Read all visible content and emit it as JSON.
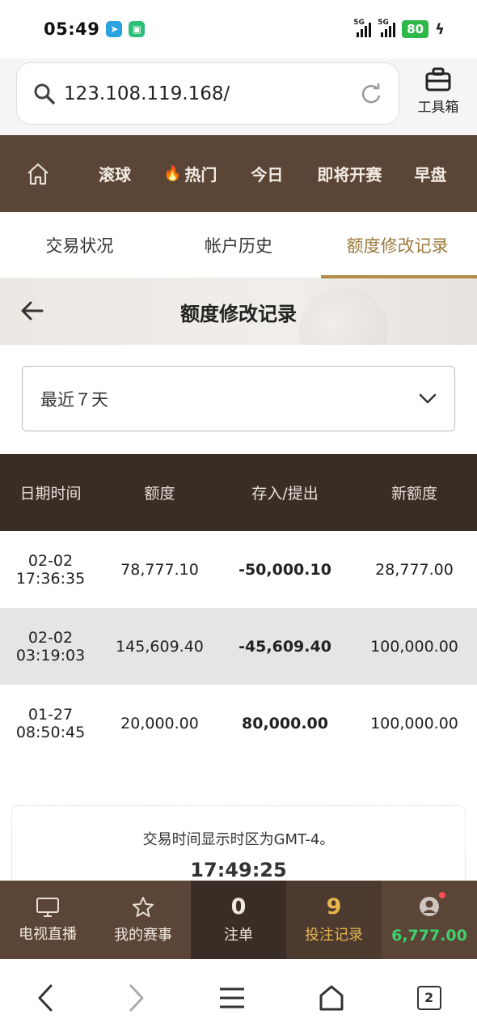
{
  "status": {
    "time": "05:49",
    "signal1": "5G",
    "signal2": "5G",
    "battery": "80"
  },
  "browser": {
    "url": "123.108.119.168/",
    "toolbox_label": "工具箱",
    "tab_count": "2"
  },
  "nav": {
    "items": [
      "滚球",
      "热门",
      "今日",
      "即将开赛",
      "早盘"
    ]
  },
  "tabs": [
    "交易状况",
    "帐户历史",
    "额度修改记录"
  ],
  "page": {
    "title": "额度修改记录"
  },
  "filter": {
    "selected": "最近７天"
  },
  "table": {
    "headers": [
      "日期时间",
      "额度",
      "存入/提出",
      "新额度"
    ],
    "rows": [
      {
        "date": "02-02",
        "time": "17:36:35",
        "credit": "78,777.10",
        "change": "-50,000.10",
        "new_credit": "28,777.00"
      },
      {
        "date": "02-02",
        "time": "03:19:03",
        "credit": "145,609.40",
        "change": "-45,609.40",
        "new_credit": "100,000.00"
      },
      {
        "date": "01-27",
        "time": "08:50:45",
        "credit": "20,000.00",
        "change": "80,000.00",
        "new_credit": "100,000.00"
      }
    ]
  },
  "note": {
    "text": "交易时间显示时区为GMT-4。",
    "time": "17:49:25"
  },
  "bottom_bar": {
    "tv": "电视直播",
    "my_events": "我的赛事",
    "bets_count": "0",
    "bets_label": "注单",
    "history_count": "9",
    "history_label": "投注记录",
    "balance": "6,777.00"
  }
}
